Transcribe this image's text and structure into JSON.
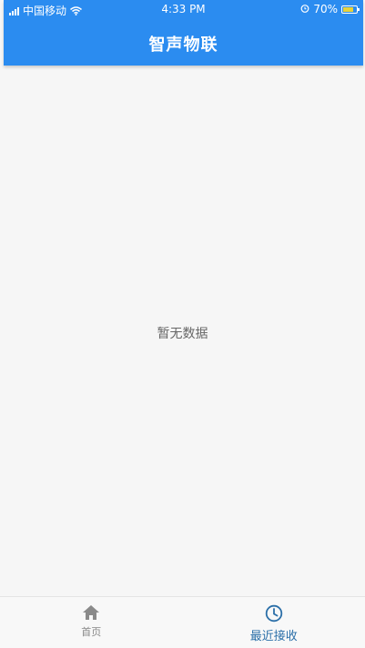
{
  "status_bar": {
    "carrier": "中国移动",
    "time": "4:33 PM",
    "battery": "70%",
    "battery_level": 0.7
  },
  "app_bar": {
    "title": "智声物联"
  },
  "content": {
    "empty_message": "暂无数据"
  },
  "bottom_nav": {
    "items": [
      {
        "label": "首页",
        "icon": "home-icon",
        "active": false
      },
      {
        "label": "最近接收",
        "icon": "clock-icon",
        "active": true
      }
    ]
  },
  "colors": {
    "primary": "#2b8cf0",
    "active_nav": "#2b6fa8",
    "inactive_nav": "#888888",
    "background": "#f6f6f6"
  }
}
